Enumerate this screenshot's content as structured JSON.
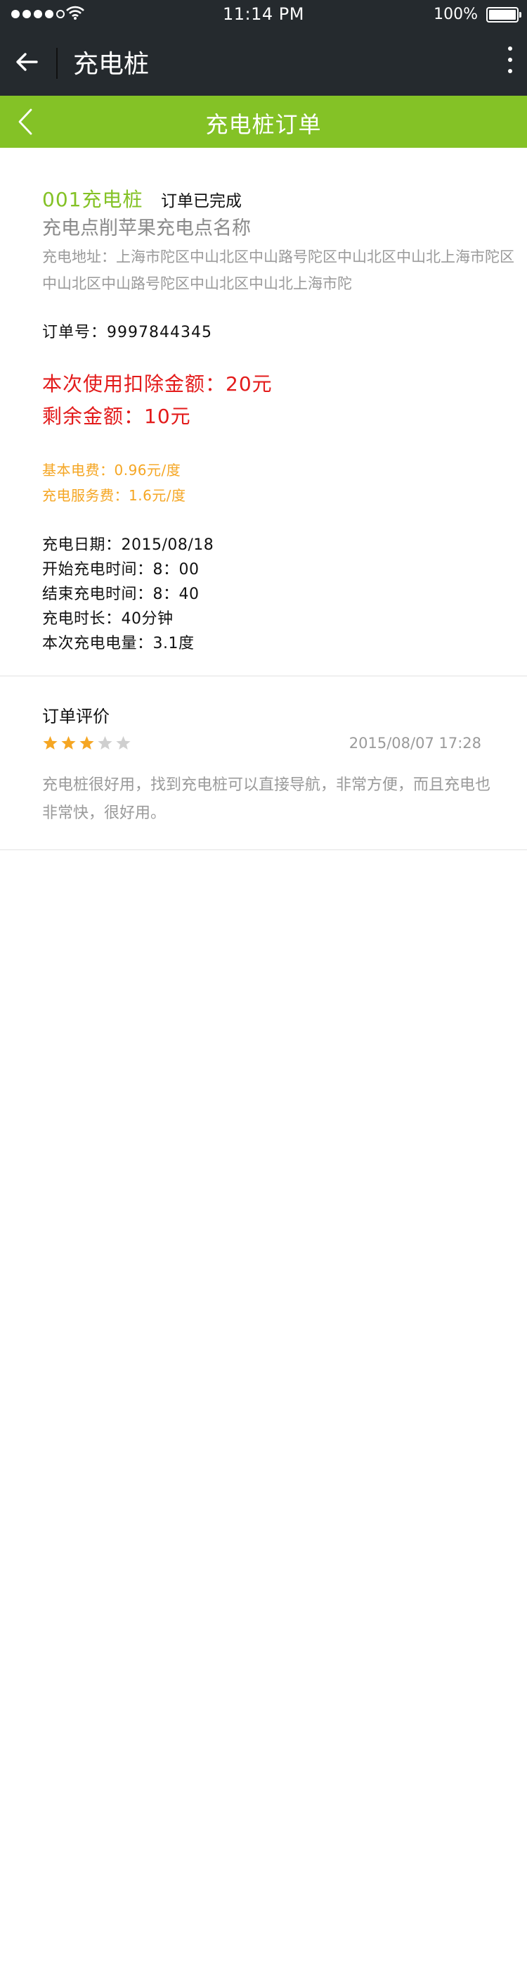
{
  "status_bar": {
    "time": "11:14 PM",
    "battery_text": "100%",
    "signal_bars_filled": 4,
    "signal_bars_total": 5
  },
  "app_bar": {
    "title": "充电桩",
    "back_icon": "arrow-left-icon",
    "menu_icon": "more-vertical-icon"
  },
  "page_header": {
    "title": "充电桩订单",
    "back_icon": "chevron-left-icon",
    "color": "#84c226"
  },
  "order": {
    "pile_name": "001充电桩",
    "status": "订单已完成",
    "station_name": "充电点削苹果充电点名称",
    "address": "充电地址：上海市陀区中山北区中山路号陀区中山北区中山北上海市陀区中山北区中山路号陀区中山北区中山北上海市陀",
    "order_no": "订单号：9997844345",
    "deduct_amount": "本次使用扣除金额：20元",
    "remaining_amount": "剩余金额：10元",
    "base_fee": "基本电费：0.96元/度",
    "service_fee": "充电服务费：1.6元/度",
    "charge_date": "充电日期：2015/08/18",
    "start_time": "开始充电时间：8：00",
    "end_time": "结束充电时间：8：40",
    "duration": "充电时长：40分钟",
    "energy": "本次充电电量：3.1度"
  },
  "review": {
    "title": "订单评价",
    "rating": 3,
    "max_rating": 5,
    "date": "2015/08/07  17:28",
    "text": "充电桩很好用，找到充电桩可以直接导航，非常方便，而且充电也非常快，很好用。",
    "star_color": "#f5a623",
    "star_empty_color": "#cfcfcf"
  },
  "colors": {
    "accent_green": "#84c226",
    "price_red": "#e31b1b",
    "fee_orange": "#f5a623",
    "topbar_dark": "#252a2e"
  }
}
